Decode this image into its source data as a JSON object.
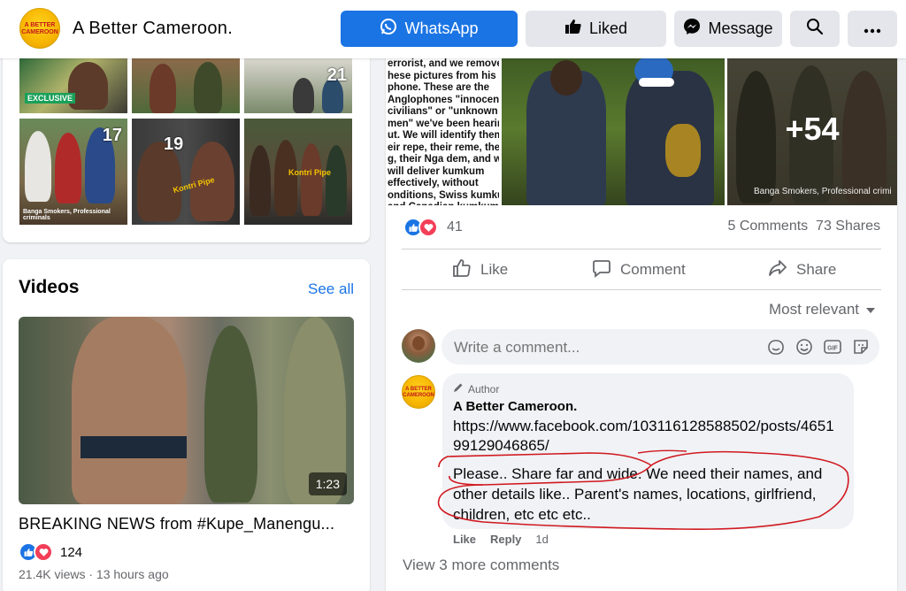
{
  "header": {
    "page_name": "A Better Cameroon.",
    "logo_text": "A BETTER CAMEROON",
    "whatsapp_label": "WhatsApp",
    "liked_label": "Liked",
    "message_label": "Message"
  },
  "photos": {
    "thumbs": [
      {
        "number": "",
        "caption": "EXCLUSIVE"
      },
      {
        "number": "",
        "caption": ""
      },
      {
        "number": "21",
        "caption": ""
      },
      {
        "number": "17",
        "caption": "Banga Smokers, Professional criminals"
      },
      {
        "number": "19",
        "caption": "Kontri Pipe"
      },
      {
        "number": "",
        "caption": "Kontri Pipe"
      }
    ]
  },
  "videos": {
    "title": "Videos",
    "see_all": "See all",
    "duration": "1:23",
    "video_title": "BREAKING NEWS from #Kupe_Manengu...",
    "reaction_count": "124",
    "meta": "21.4K views · 13 hours ago"
  },
  "post": {
    "image_text_lines": [
      "errorist, and we removed",
      "hese pictures from his",
      "phone. These are the",
      "Anglophones \"innocent",
      "civilians\" or \"unknown",
      "men\" we've been hearing",
      "ut. We will identify them,",
      "eir repe, their reme, they",
      "g, their Nga dem, and we",
      "will deliver kumkum",
      "effectively, without",
      "onditions, Swiss kumkum",
      "and Canadian kumkum."
    ],
    "more_photos": "+54",
    "image3_caption": "Banga Smokers, Professional crimi",
    "reactions_count": "41",
    "comments_shares": "5 Comments  73 Shares",
    "actions": {
      "like": "Like",
      "comment": "Comment",
      "share": "Share"
    },
    "sort_label": "Most relevant",
    "comment_placeholder": "Write a comment..."
  },
  "comment": {
    "badge": "Author",
    "author": "A Better Cameroon.",
    "link": "https://www.facebook.com/103116128588502/posts/465199129046865/",
    "text": "Please.. Share far and wide. We need their names, and other details like.. Parent's names, locations, girlfriend, children, etc etc etc..",
    "like": "Like",
    "reply": "Reply",
    "time": "1d",
    "view_more": "View 3 more comments"
  },
  "colors": {
    "brand_blue": "#1b74e4",
    "love_red": "#f33e58",
    "scribble_red": "#d0181f",
    "page_bg": "#f0f2f5"
  }
}
